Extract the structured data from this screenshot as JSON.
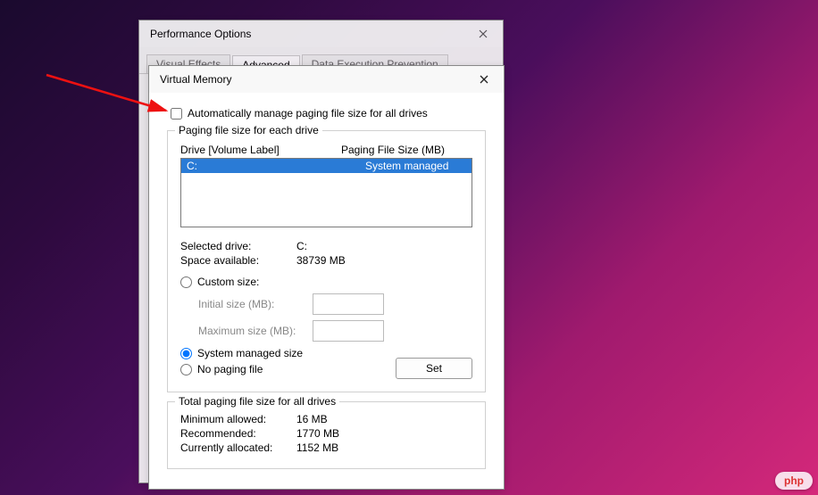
{
  "perf_window": {
    "title": "Performance Options",
    "tabs": {
      "visual": "Visual Effects",
      "advanced": "Advanced",
      "dep": "Data Execution Prevention"
    }
  },
  "vm": {
    "title": "Virtual Memory",
    "auto_manage": "Automatically manage paging file size for all drives",
    "group_title": "Paging file size for each drive",
    "header_drive": "Drive  [Volume Label]",
    "header_size": "Paging File Size (MB)",
    "row_drive": "C:",
    "row_size": "System managed",
    "selected_label": "Selected drive:",
    "selected_value": "C:",
    "space_label": "Space available:",
    "space_value": "38739 MB",
    "custom_size": "Custom size:",
    "initial_label": "Initial size (MB):",
    "max_label": "Maximum size (MB):",
    "system_managed": "System managed size",
    "no_paging": "No paging file",
    "set_btn": "Set",
    "totals_title": "Total paging file size for all drives",
    "min_label": "Minimum allowed:",
    "min_value": "16 MB",
    "rec_label": "Recommended:",
    "rec_value": "1770 MB",
    "cur_label": "Currently allocated:",
    "cur_value": "1152 MB"
  },
  "watermark": "php"
}
